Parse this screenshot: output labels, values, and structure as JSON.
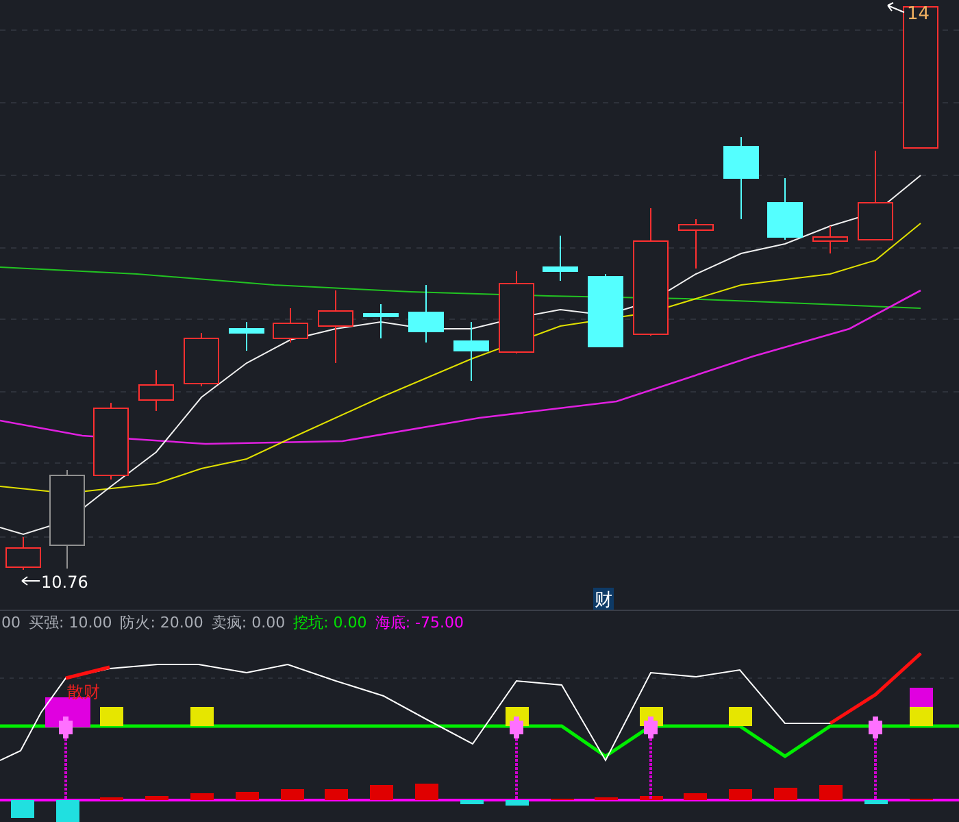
{
  "price_chart": {
    "high_label": "14",
    "low_label": "10.76",
    "marker_label": "财"
  },
  "indicator": {
    "legend": [
      {
        "text": "00",
        "color": "#a8acb4"
      },
      {
        "text": "买强: 10.00",
        "color": "#a8acb4"
      },
      {
        "text": "防火: 20.00",
        "color": "#a8acb4"
      },
      {
        "text": "卖疯: 0.00",
        "color": "#a8acb4"
      },
      {
        "text": "挖坑: 0.00",
        "color": "#00e000"
      },
      {
        "text": "海底: -75.00",
        "color": "#ff00ff"
      }
    ],
    "signal_label": "散财"
  }
}
